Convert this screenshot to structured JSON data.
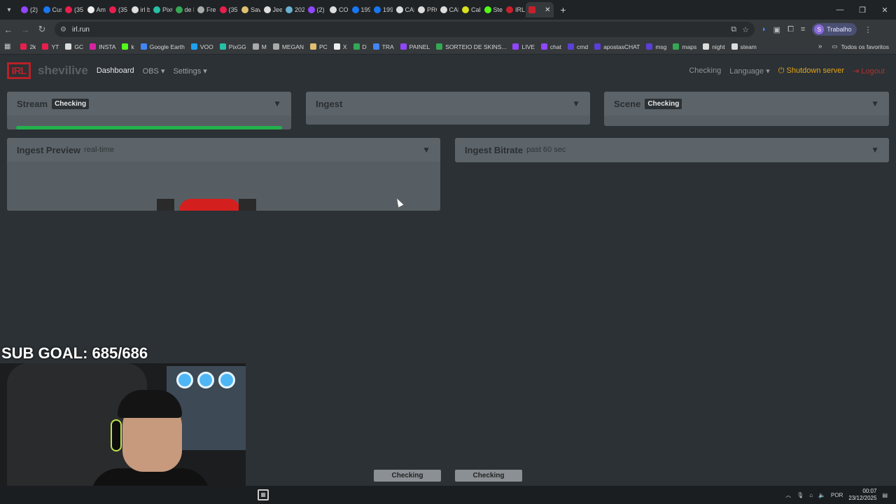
{
  "browser": {
    "tabs": [
      {
        "label": "(2)",
        "color": "#9146ff"
      },
      {
        "label": "Cus",
        "color": "#1877f2"
      },
      {
        "label": "(35",
        "color": "#e91e4d"
      },
      {
        "label": "Am",
        "color": "#eeeeee"
      },
      {
        "label": "(35",
        "color": "#e91e4d"
      },
      {
        "label": "irl b",
        "color": "#dddddd"
      },
      {
        "label": "PixC",
        "color": "#26c0a6"
      },
      {
        "label": "de l",
        "color": "#34a853"
      },
      {
        "label": "Frei",
        "color": "#aaaaaa"
      },
      {
        "label": "(35",
        "color": "#e91e4d"
      },
      {
        "label": "Sav",
        "color": "#e0c070"
      },
      {
        "label": "Jee",
        "color": "#dddddd"
      },
      {
        "label": "202",
        "color": "#6ab0d0"
      },
      {
        "label": "(2)",
        "color": "#9146ff"
      },
      {
        "label": "COI",
        "color": "#dddddd"
      },
      {
        "label": "199",
        "color": "#1877f2"
      },
      {
        "label": "199",
        "color": "#1877f2"
      },
      {
        "label": "CAI",
        "color": "#dddddd"
      },
      {
        "label": "PRC",
        "color": "#dddddd"
      },
      {
        "label": "CAL",
        "color": "#dddddd"
      },
      {
        "label": "Calc",
        "color": "#d8e020"
      },
      {
        "label": "Ste",
        "color": "#53fc18"
      },
      {
        "label": "IRLI",
        "color": "#c8202a"
      }
    ],
    "active_tab": {
      "label": "",
      "color": "#c8202a",
      "close_icon": "close-icon"
    },
    "url": "irl.run",
    "profile_initial": "S",
    "profile_label": "Trabalho",
    "bookmarks": [
      {
        "label": "2k",
        "color": "#e91e4d"
      },
      {
        "label": "YT",
        "color": "#e91e4d"
      },
      {
        "label": "GC",
        "color": "#dddddd"
      },
      {
        "label": "INSTA",
        "color": "#d6249f"
      },
      {
        "label": "k",
        "color": "#53fc18"
      },
      {
        "label": "Google Earth",
        "color": "#4285f4"
      },
      {
        "label": "VOO",
        "color": "#1da1f2"
      },
      {
        "label": "PixGG",
        "color": "#26c0a6"
      },
      {
        "label": "M",
        "color": "#aaaaaa"
      },
      {
        "label": "MEGAN",
        "color": "#aaaaaa"
      },
      {
        "label": "PC",
        "color": "#e0c070"
      },
      {
        "label": "X",
        "color": "#eeeeee"
      },
      {
        "label": "D",
        "color": "#34a853"
      },
      {
        "label": "TRA",
        "color": "#4285f4"
      },
      {
        "label": "PAINEL",
        "color": "#9146ff"
      },
      {
        "label": "SORTEIO DE SKINS...",
        "color": "#34a853"
      },
      {
        "label": "LIVE",
        "color": "#9146ff"
      },
      {
        "label": "chat",
        "color": "#9146ff"
      },
      {
        "label": "cmd",
        "color": "#5b3fd8"
      },
      {
        "label": "apostasCHAT",
        "color": "#5b3fd8"
      },
      {
        "label": "msg",
        "color": "#5b3fd8"
      },
      {
        "label": "maps",
        "color": "#34a853"
      },
      {
        "label": "night",
        "color": "#dddddd"
      },
      {
        "label": "steam",
        "color": "#dddddd"
      }
    ],
    "all_bookmarks_label": "Todos os favoritos"
  },
  "app": {
    "logo": "IRL",
    "brand": "shevilive",
    "nav": [
      {
        "label": "Dashboard",
        "active": true
      },
      {
        "label": "OBS ▾",
        "active": false
      },
      {
        "label": "Settings ▾",
        "active": false
      }
    ],
    "status": "Checking",
    "language": "Language ▾",
    "shutdown": "Shutdown server",
    "logout": "Logout"
  },
  "cards": {
    "stream": {
      "title": "Stream",
      "badge": "Checking",
      "progress_fraction": 1.0
    },
    "ingest": {
      "title": "Ingest"
    },
    "scene": {
      "title": "Scene",
      "badge": "Checking"
    },
    "preview": {
      "title": "Ingest Preview",
      "subtitle": "real-time"
    },
    "bitrate": {
      "title": "Ingest Bitrate",
      "subtitle": "past 60 sec"
    }
  },
  "overlay": {
    "sub_goal": "SUB GOAL: 685/686",
    "status_left": "Checking",
    "status_right": "Checking"
  },
  "taskbar": {
    "lang": "POR",
    "time": "00:07",
    "date": "23/12/2025"
  },
  "colors": {
    "accent_green": "#22b14c",
    "shutdown_yellow": "#e6a417",
    "logout_red": "#b03030",
    "logo_red": "#b82027"
  }
}
